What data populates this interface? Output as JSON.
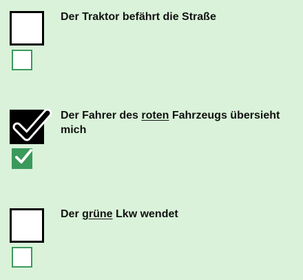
{
  "options": [
    {
      "checked": false,
      "text_before": "Der Traktor befährt die Straße",
      "emphasis": "",
      "text_after": ""
    },
    {
      "checked": true,
      "text_before": "Der Fahrer des ",
      "emphasis": "roten",
      "text_after": " Fahrzeugs übersieht mich"
    },
    {
      "checked": false,
      "text_before": "Der ",
      "emphasis": "grüne",
      "text_after": " Lkw wendet"
    }
  ],
  "icons": {
    "checkmark": "checkmark-icon"
  },
  "colors": {
    "background": "#d9f2d9",
    "answer_box": "#3a9a5b",
    "checked_box": "#000000"
  }
}
